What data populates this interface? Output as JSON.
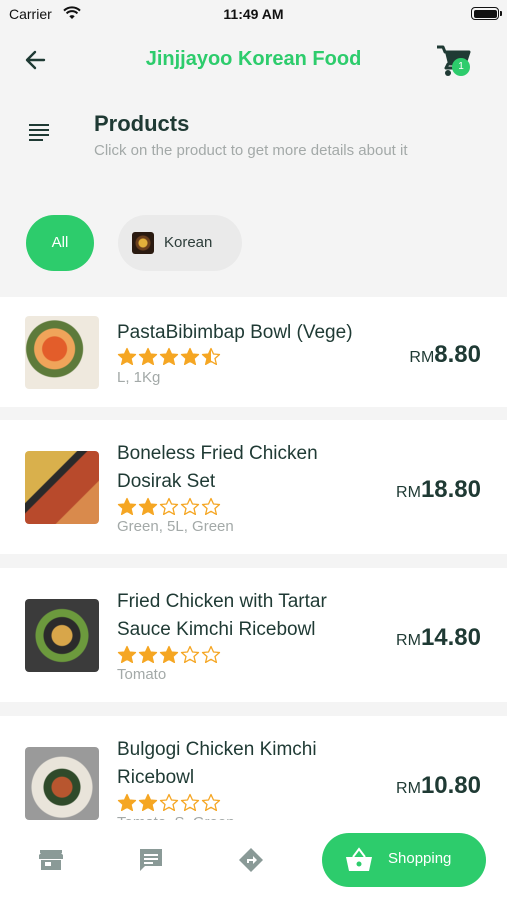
{
  "status_bar": {
    "carrier": "Carrier",
    "time": "11:49 AM"
  },
  "header": {
    "title": "Jinjjayoo Korean Food",
    "cart_count": "1"
  },
  "page": {
    "title": "Products",
    "subtitle": "Click on the product to get more details about it"
  },
  "categories": [
    {
      "label": "All",
      "selected": true
    },
    {
      "label": "Korean",
      "selected": false
    }
  ],
  "currency": "RM",
  "products": [
    {
      "name_lines": [
        "PastaBibimbap Bowl (Vege)"
      ],
      "rating": 4.5,
      "variant": "L, 1Kg",
      "price": "8.80"
    },
    {
      "name_lines": [
        "Boneless Fried Chicken",
        "Dosirak Set"
      ],
      "rating": 2,
      "variant": "Green, 5L, Green",
      "price": "18.80"
    },
    {
      "name_lines": [
        "Fried Chicken with Tartar",
        "Sauce Kimchi Ricebowl"
      ],
      "rating": 3,
      "variant": "Tomato",
      "price": "14.80"
    },
    {
      "name_lines": [
        "Bulgogi Chicken Kimchi",
        "Ricebowl"
      ],
      "rating": 2,
      "variant": "Tomato, S, Green",
      "price": "10.80"
    }
  ],
  "bottom_nav": {
    "items": [
      "store-icon",
      "chat-icon",
      "directions-icon"
    ],
    "active_label": "Shopping",
    "active_icon": "basket-icon"
  },
  "colors": {
    "accent": "#2dcc6c",
    "star": "#f5a623",
    "text_dark": "#1f3a34",
    "muted": "#a3a9a8"
  }
}
